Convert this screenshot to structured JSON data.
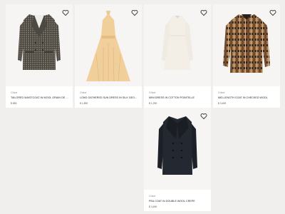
{
  "products": [
    {
      "brand": "Chloé",
      "name": "Tailored waistcoat in wool grain de poudre",
      "price": "$ 850",
      "image": "plaid-blazer",
      "wishlist_icon": "heart-outline-icon"
    },
    {
      "brand": "Chloé",
      "name": "Long gathered sun dress in silk georgette",
      "price": "$ 1,890",
      "image": "peach-halter-maxi-dress",
      "wishlist_icon": "heart-outline-icon"
    },
    {
      "brand": "Chloé",
      "name": "Mini dress in cotton pointelle",
      "price": "$ 1,290",
      "image": "cream-long-sleeve-mini-dress",
      "wishlist_icon": "heart-outline-icon"
    },
    {
      "brand": "Chloé",
      "name": "Mid-length coat in checked wool",
      "price": "$ 3,490",
      "image": "brown-check-coat",
      "wishlist_icon": "heart-outline-icon"
    },
    {
      "brand": "Chloé",
      "name": "Pea coat in double wool crepe",
      "price": "$ 3,490",
      "image": "navy-pea-coat",
      "wishlist_icon": "heart-outline-icon"
    }
  ]
}
